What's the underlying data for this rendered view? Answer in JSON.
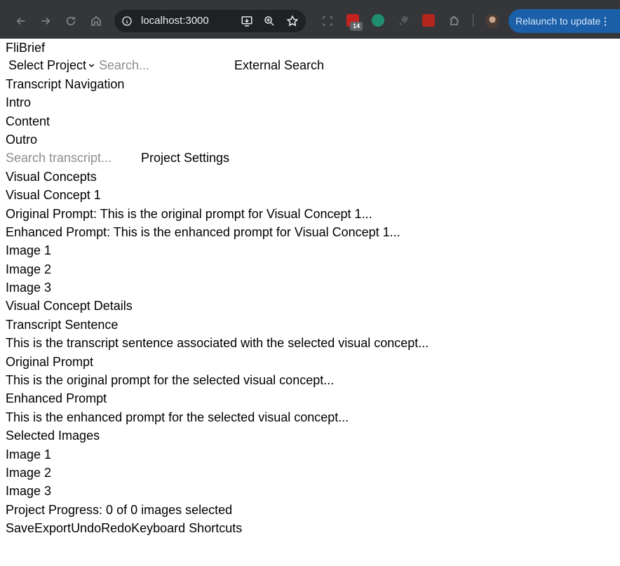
{
  "browser": {
    "url": "localhost:3000",
    "extension_badge": "14",
    "relaunch_label": "Relaunch to update",
    "relaunch_menu": "⋮"
  },
  "app": {
    "title": "FliBrief",
    "project_select": {
      "selected": "Select Project"
    },
    "search": {
      "placeholder": "Search..."
    },
    "external_search_label": "External Search"
  },
  "transcript_nav": {
    "heading": "Transcript Navigation",
    "items": [
      "Intro",
      "Content",
      "Outro"
    ],
    "search_placeholder": "Search transcript...",
    "project_settings_label": "Project Settings"
  },
  "visual_concepts": {
    "heading": "Visual Concepts",
    "concept": {
      "title": "Visual Concept 1",
      "original_prompt": "Original Prompt: This is the original prompt for Visual Concept 1...",
      "enhanced_prompt": "Enhanced Prompt: This is the enhanced prompt for Visual Concept 1...",
      "images": [
        "Image 1",
        "Image 2",
        "Image 3"
      ]
    }
  },
  "details": {
    "heading": "Visual Concept Details",
    "transcript_label": "Transcript Sentence",
    "transcript_text": "This is the transcript sentence associated with the selected visual concept...",
    "original_label": "Original Prompt",
    "original_text": "This is the original prompt for the selected visual concept...",
    "enhanced_label": "Enhanced Prompt",
    "enhanced_text": "This is the enhanced prompt for the selected visual concept...",
    "selected_images_label": "Selected Images",
    "selected_images": [
      "Image 1",
      "Image 2",
      "Image 3"
    ]
  },
  "progress": {
    "text": "Project Progress: 0 of 0 images selected"
  },
  "toolbar": {
    "save": "Save",
    "export": "Export",
    "undo": "Undo",
    "redo": "Redo",
    "shortcuts": "Keyboard Shortcuts"
  }
}
